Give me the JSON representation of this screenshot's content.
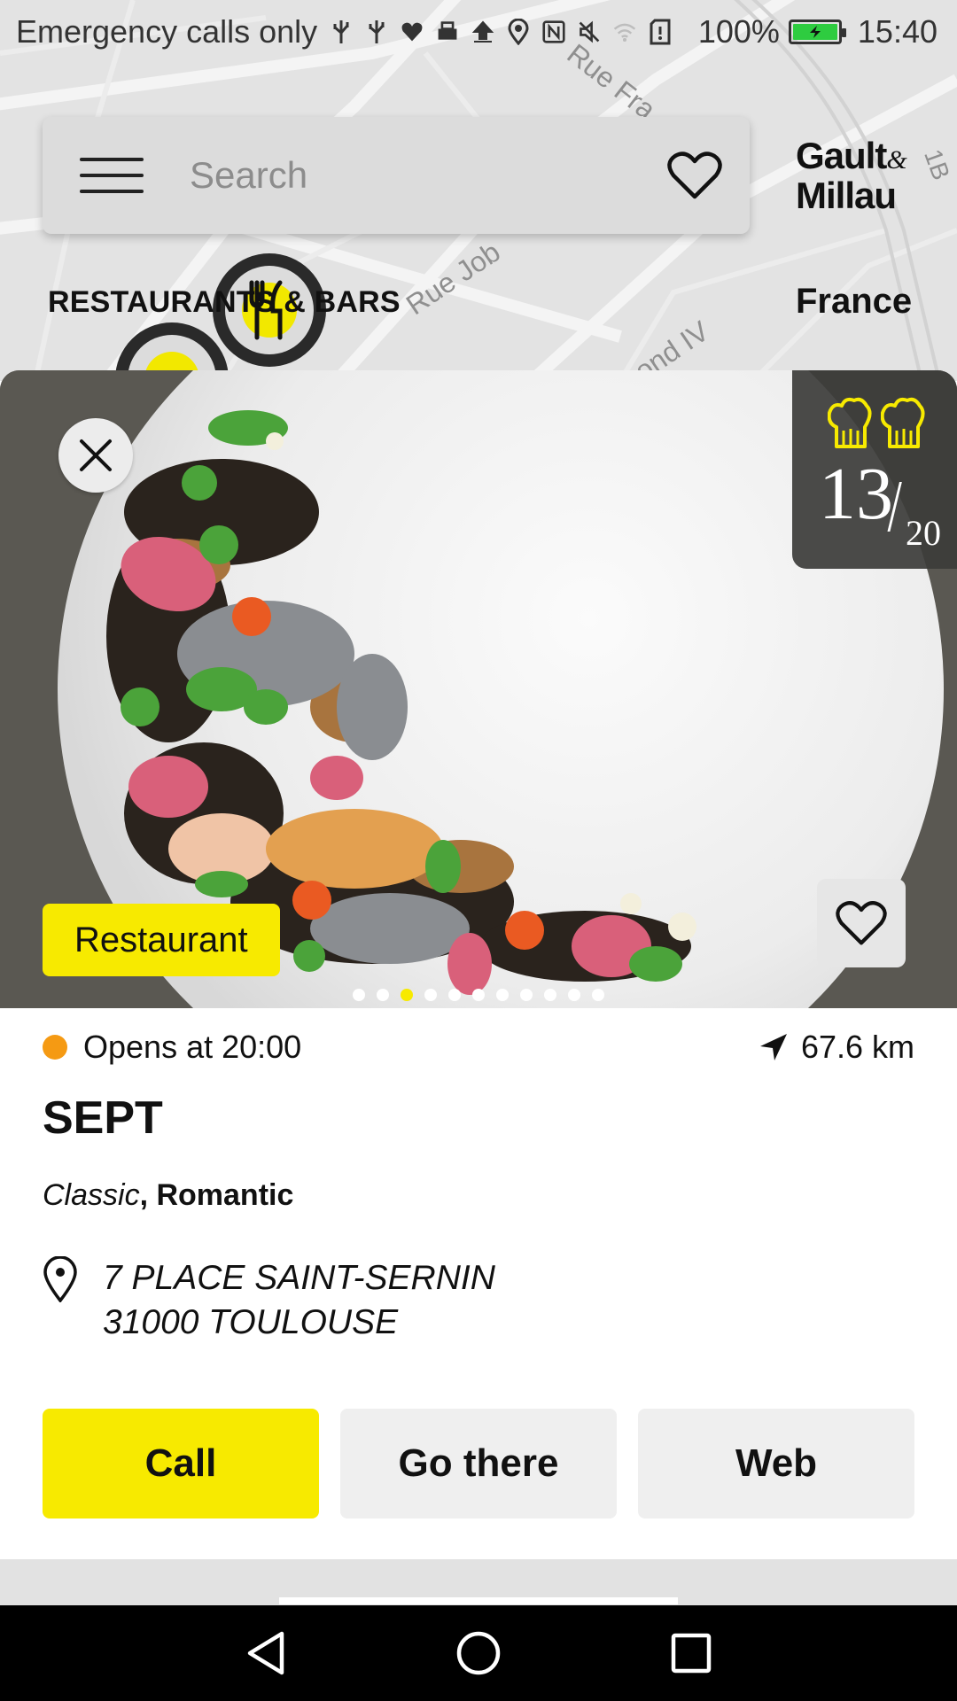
{
  "status_bar": {
    "carrier": "Emergency calls only",
    "battery_percent": "100%",
    "time": "15:40",
    "icons": [
      "usb-icon",
      "usb-icon",
      "health-icon",
      "printer-icon",
      "upload-icon",
      "location-icon",
      "nfc-icon",
      "mute-icon",
      "wifi-icon",
      "sim-alert-icon",
      "battery-charging-icon"
    ]
  },
  "search": {
    "placeholder": "Search"
  },
  "brand": {
    "line1": "Gault",
    "amp": "&",
    "line2": "Millau"
  },
  "map": {
    "category": "RESTAURANTS & BARS",
    "region": "France",
    "streets": [
      "Rue Fra",
      "Rue Job",
      "ond IV",
      "1B"
    ]
  },
  "restaurant": {
    "rating": {
      "toques": 2,
      "score": "13",
      "out_of": "20"
    },
    "type": "Restaurant",
    "photo_count": 11,
    "photo_index": 3,
    "open_status": "Opens at 20:00",
    "distance": "67.6 km",
    "name": "SEPT",
    "style": "Classic",
    "mood": ", Romantic",
    "address_line1": "7 PLACE SAINT-SERNIN",
    "address_line2": "31000 TOULOUSE"
  },
  "actions": {
    "call": "Call",
    "go_there": "Go there",
    "web": "Web"
  },
  "colors": {
    "accent_yellow": "#f7ea00",
    "open_orange": "#f59a13",
    "button_grey": "#efefef"
  }
}
